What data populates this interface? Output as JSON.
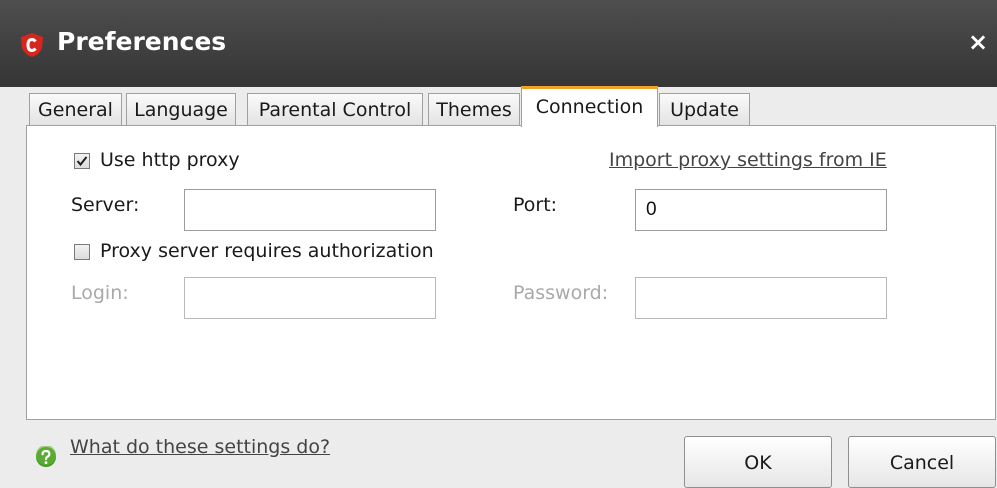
{
  "window": {
    "title": "Preferences",
    "close_glyph": "×"
  },
  "tabs": [
    {
      "label": "General"
    },
    {
      "label": "Language"
    },
    {
      "label": "Parental Control"
    },
    {
      "label": "Themes"
    },
    {
      "label": "Connection",
      "active": true
    },
    {
      "label": "Update"
    }
  ],
  "connection": {
    "use_proxy": {
      "label": "Use http proxy",
      "checked": true
    },
    "import_link": "Import proxy settings from IE",
    "server": {
      "label": "Server:",
      "value": ""
    },
    "port": {
      "label": "Port:",
      "value": "0"
    },
    "requires_auth": {
      "label": "Proxy server requires authorization",
      "checked": false
    },
    "login": {
      "label": "Login:",
      "value": "",
      "disabled": true
    },
    "password": {
      "label": "Password:",
      "value": "",
      "disabled": true
    }
  },
  "footer": {
    "help_link": "What do these settings do?",
    "ok_label": "OK",
    "cancel_label": "Cancel"
  },
  "colors": {
    "titlebar": "#404040",
    "active_tab_accent": "#f0a128",
    "logo_red": "#d7261e",
    "help_green": "#4a9a2a"
  },
  "icons": {
    "app_logo": "comodo-shield-icon",
    "close": "close-icon",
    "checkmark": "checkmark-icon",
    "help": "help-icon"
  }
}
